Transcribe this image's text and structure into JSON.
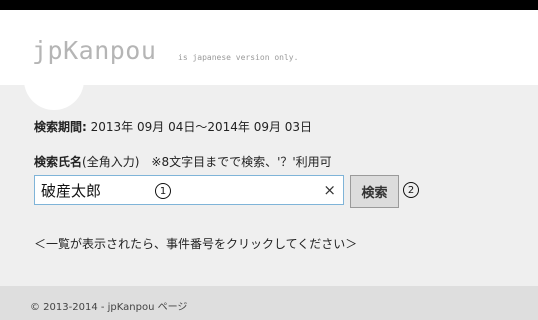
{
  "header": {
    "brand": "jpKanpou",
    "tagline": "is japanese version only."
  },
  "search": {
    "period_label": "検索期間:",
    "period_value": " 2013年 09月 04日～2014年 09月 03日",
    "name_label": "検索氏名",
    "name_hint": "(全角入力)",
    "name_note": "※8文字目までで検索、'？'利用可",
    "input_value": "破産太郎",
    "input_marker": "1",
    "clear_icon": "×",
    "button_label": "検索",
    "button_marker": "2"
  },
  "instruction": "＜一覧が表示されたら、事件番号をクリックしてください＞",
  "footer": {
    "copyright": "© 2013-2014 - jpKanpou ページ"
  }
}
